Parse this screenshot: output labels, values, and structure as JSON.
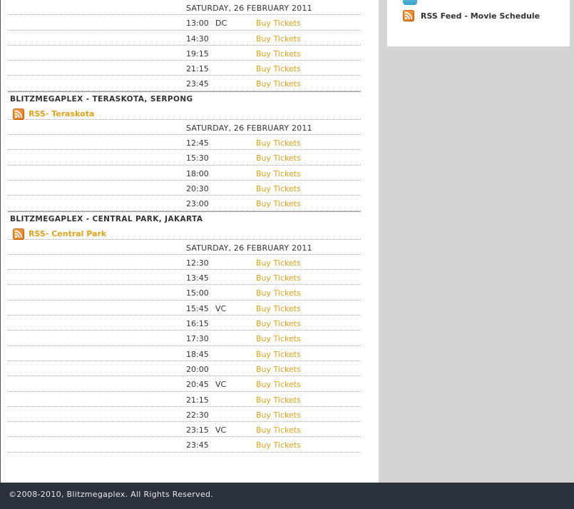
{
  "schedules": [
    {
      "date": "SATURDAY, 26 FEBRUARY 2011",
      "rows": [
        {
          "time": "13:00",
          "format": "DC",
          "buy": "Buy Tickets"
        },
        {
          "time": "14:30",
          "format": "",
          "buy": "Buy Tickets"
        },
        {
          "time": "19:15",
          "format": "",
          "buy": "Buy Tickets"
        },
        {
          "time": "21:15",
          "format": "",
          "buy": "Buy Tickets"
        },
        {
          "time": "23:45",
          "format": "",
          "buy": "Buy Tickets"
        }
      ]
    },
    {
      "cinema": "BLITZMEGAPLEX - TERASKOTA, SERPONG",
      "rss": "RSS- Teraskota",
      "date": "SATURDAY, 26 FEBRUARY 2011",
      "rows": [
        {
          "time": "12:45",
          "format": "",
          "buy": "Buy Tickets"
        },
        {
          "time": "15:30",
          "format": "",
          "buy": "Buy Tickets"
        },
        {
          "time": "18:00",
          "format": "",
          "buy": "Buy Tickets"
        },
        {
          "time": "20:30",
          "format": "",
          "buy": "Buy Tickets"
        },
        {
          "time": "23:00",
          "format": "",
          "buy": "Buy Tickets"
        }
      ]
    },
    {
      "cinema": "BLITZMEGAPLEX - CENTRAL PARK, JAKARTA",
      "rss": "RSS- Central Park",
      "date": "SATURDAY, 26 FEBRUARY 2011",
      "rows": [
        {
          "time": "12:30",
          "format": "",
          "buy": "Buy Tickets"
        },
        {
          "time": "13:45",
          "format": "",
          "buy": "Buy Tickets"
        },
        {
          "time": "15:00",
          "format": "",
          "buy": "Buy Tickets"
        },
        {
          "time": "15:45",
          "format": "VC",
          "buy": "Buy Tickets"
        },
        {
          "time": "16:15",
          "format": "",
          "buy": "Buy Tickets"
        },
        {
          "time": "17:30",
          "format": "",
          "buy": "Buy Tickets"
        },
        {
          "time": "18:45",
          "format": "",
          "buy": "Buy Tickets"
        },
        {
          "time": "20:00",
          "format": "",
          "buy": "Buy Tickets"
        },
        {
          "time": "20:45",
          "format": "VC",
          "buy": "Buy Tickets"
        },
        {
          "time": "21:15",
          "format": "",
          "buy": "Buy Tickets"
        },
        {
          "time": "22:30",
          "format": "",
          "buy": "Buy Tickets"
        },
        {
          "time": "23:15",
          "format": "VC",
          "buy": "Buy Tickets"
        },
        {
          "time": "23:45",
          "format": "",
          "buy": "Buy Tickets"
        }
      ]
    }
  ],
  "sidebar": {
    "rss_label": "RSS Feed - Movie Schedule",
    "top_icon": "social-icon",
    "rss_icon": "rss-icon"
  },
  "footer": {
    "copyright": "©2008-2010, Blitzmegaplex. All Rights Reserved."
  },
  "colors": {
    "link": "#e2a11a",
    "footer_bg": "#2b323c",
    "page_bg": "#d4d4d4"
  }
}
